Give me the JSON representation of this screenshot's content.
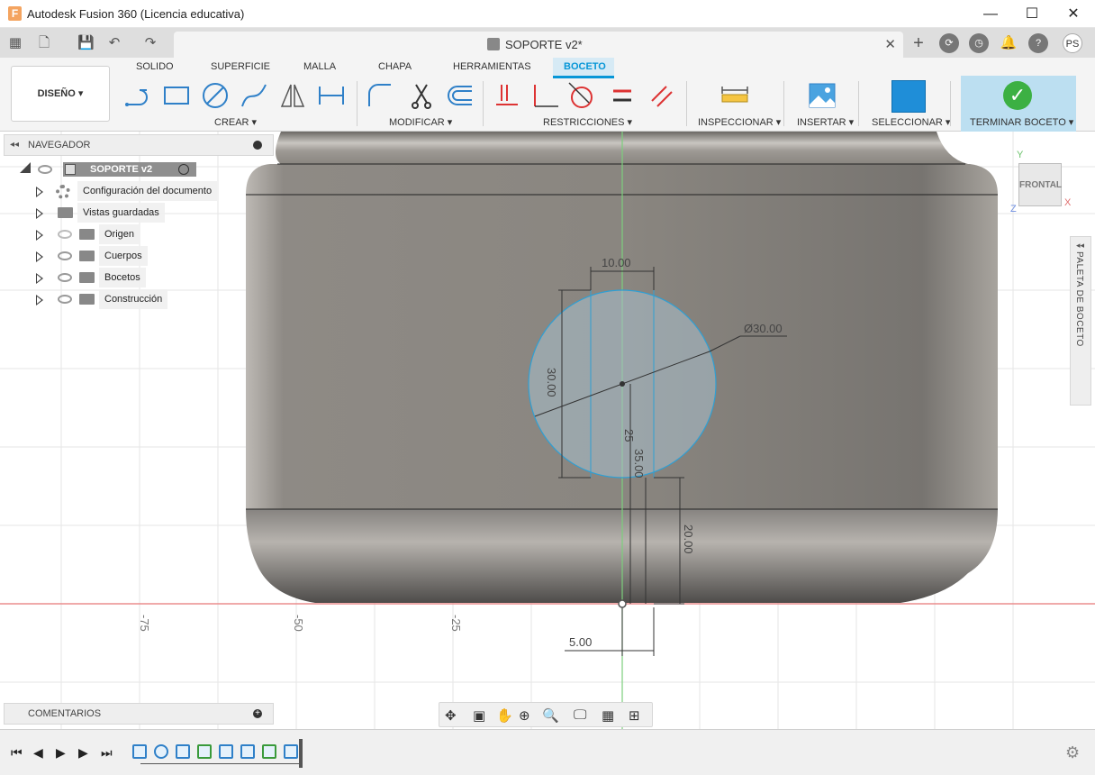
{
  "window": {
    "title": "Autodesk Fusion 360 (Licencia educativa)",
    "minimize": "—",
    "maximize": "☐",
    "close": "✕"
  },
  "tabs": {
    "document_title": "SOPORTE v2*",
    "close": "✕"
  },
  "user": {
    "initials": "PS"
  },
  "ribbon": {
    "workspace": "DISEÑO ▾",
    "tabs": [
      "SOLIDO",
      "SUPERFICIE",
      "MALLA",
      "CHAPA",
      "HERRAMIENTAS",
      "BOCETO"
    ],
    "active_tab": "BOCETO",
    "groups": {
      "crear": "CREAR ▾",
      "modificar": "MODIFICAR ▾",
      "restricciones": "RESTRICCIONES ▾",
      "inspeccionar": "INSPECCIONAR ▾",
      "insertar": "INSERTAR ▾",
      "seleccionar": "SELECCIONAR ▾",
      "terminar": "TERMINAR BOCETO ▾"
    }
  },
  "browser": {
    "title": "NAVEGADOR",
    "root": "SOPORTE v2",
    "items": [
      {
        "label": "Configuración del documento",
        "icon": "gear-icon"
      },
      {
        "label": "Vistas guardadas",
        "icon": "folder-icon"
      },
      {
        "label": "Origen",
        "icon": "folder-icon"
      },
      {
        "label": "Cuerpos",
        "icon": "folder-icon"
      },
      {
        "label": "Bocetos",
        "icon": "folder-icon"
      },
      {
        "label": "Construcción",
        "icon": "folder-icon"
      }
    ]
  },
  "comments": {
    "title": "COMENTARIOS"
  },
  "viewcube": {
    "face": "FRONTAL",
    "x": "X",
    "y": "Y",
    "z": "Z"
  },
  "palette": {
    "title": "PALETA DE BOCETO"
  },
  "dimensions": {
    "width_top": "10.00",
    "diameter": "Ø30.00",
    "height_circle": "30.00",
    "center_short": "25",
    "center_height": "35.00",
    "right_height": "20.00",
    "bottom_offset": "5.00"
  },
  "axis_ticks": [
    "-75",
    "-50",
    "-25"
  ],
  "colors": {
    "accent": "#0696d7",
    "finish_green": "#3cb043",
    "sketch_blue": "#2f9fd3",
    "x_axis_red": "#e87878"
  }
}
